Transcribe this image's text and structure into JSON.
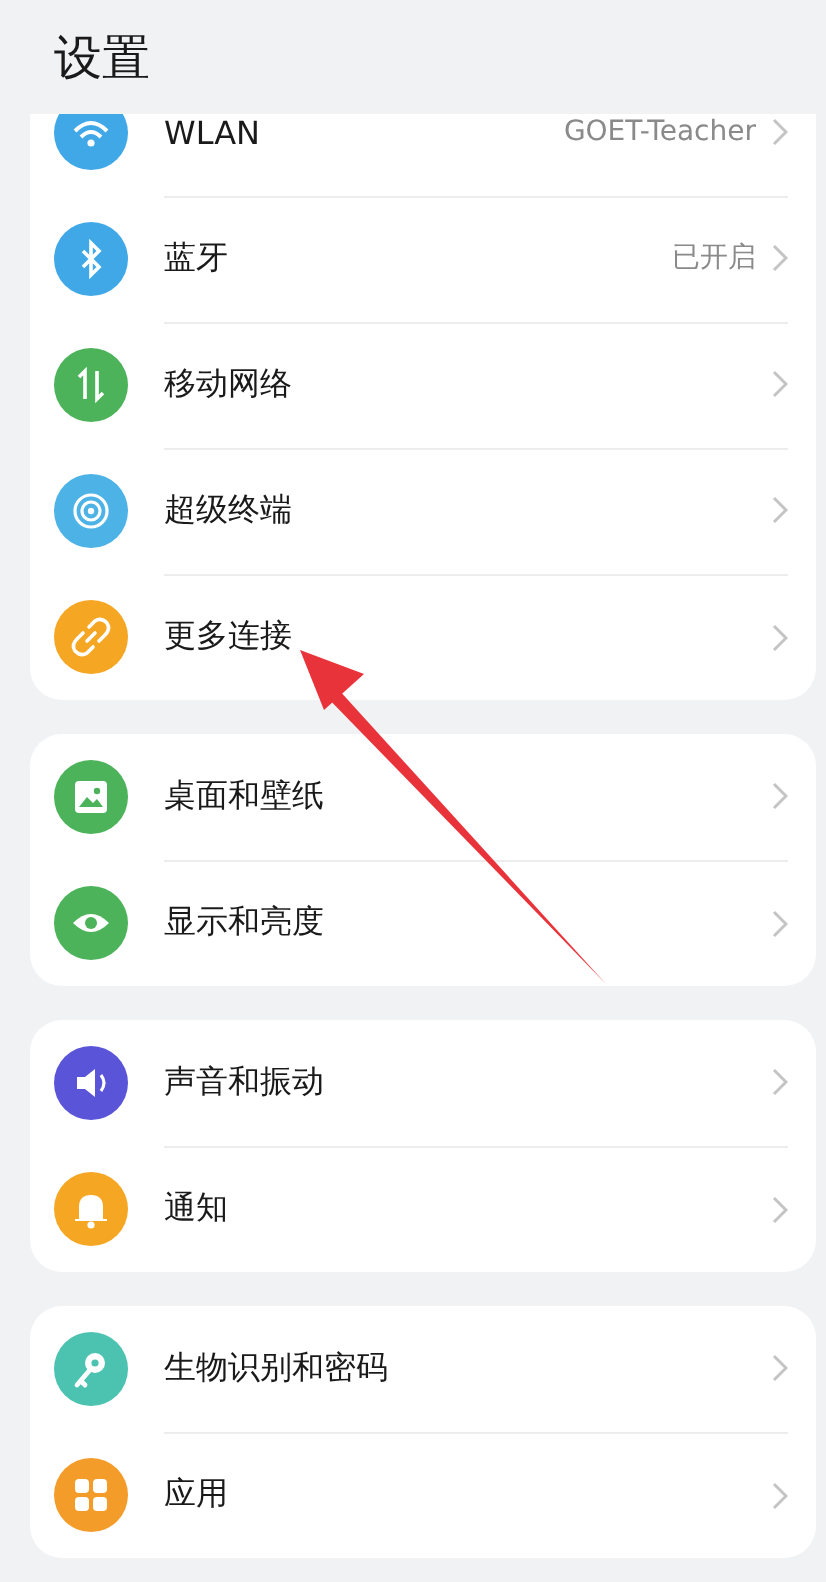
{
  "header": {
    "title": "设置"
  },
  "groups": [
    {
      "rows": [
        {
          "label": "WLAN",
          "value": "GOET-Teacher",
          "kind": "wifi",
          "color": "#41a8e8"
        },
        {
          "label": "蓝牙",
          "value": "已开启",
          "kind": "bluetooth",
          "color": "#41a8e8"
        },
        {
          "label": "移动网络",
          "kind": "updown",
          "color": "#4cb35a"
        },
        {
          "label": "超级终端",
          "kind": "target",
          "color": "#4db2e6"
        },
        {
          "label": "更多连接",
          "kind": "link",
          "color": "#f5a623"
        }
      ]
    },
    {
      "rows": [
        {
          "label": "桌面和壁纸",
          "kind": "image",
          "color": "#4cb35a"
        },
        {
          "label": "显示和亮度",
          "kind": "eye",
          "color": "#4cb35a"
        }
      ]
    },
    {
      "rows": [
        {
          "label": "声音和振动",
          "kind": "speaker",
          "color": "#5a55d8"
        },
        {
          "label": "通知",
          "kind": "bell",
          "color": "#f5a623"
        }
      ]
    },
    {
      "rows": [
        {
          "label": "生物识别和密码",
          "kind": "key",
          "color": "#4cc2b0"
        },
        {
          "label": "应用",
          "kind": "grid",
          "color": "#f39c2a"
        }
      ]
    }
  ],
  "annotation": {
    "kind": "arrow"
  }
}
